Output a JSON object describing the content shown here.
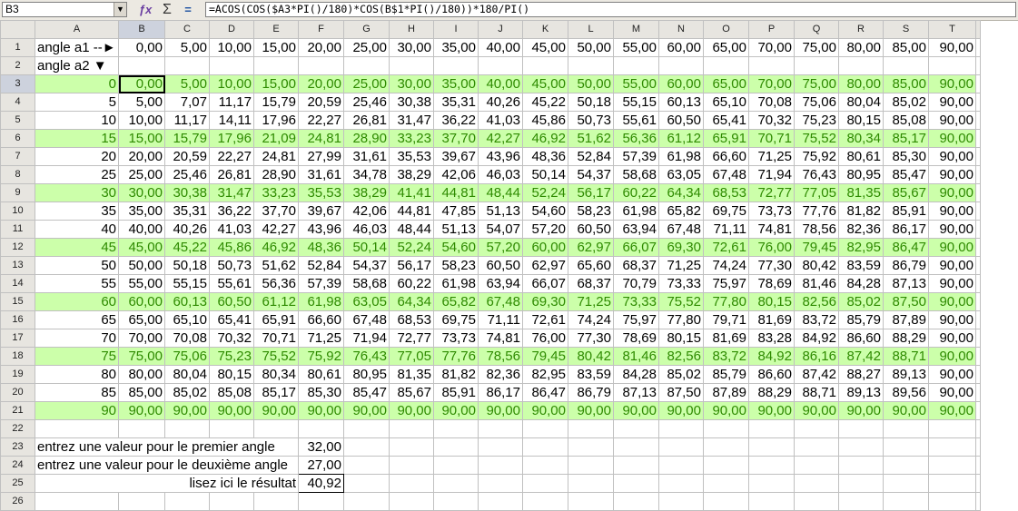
{
  "toolbar": {
    "cell_ref": "B3",
    "formula": "=ACOS(COS($A3*PI()/180)*COS(B$1*PI()/180))*180/PI()",
    "icons": [
      "function-wizard-icon",
      "sum-icon",
      "equals-icon"
    ]
  },
  "columns": [
    "A",
    "B",
    "C",
    "D",
    "E",
    "F",
    "G",
    "H",
    "I",
    "J",
    "K",
    "L",
    "M",
    "N",
    "O",
    "P",
    "Q",
    "R",
    "S",
    "T"
  ],
  "row1": {
    "label": "angle a1 --►",
    "values": [
      "0,00",
      "5,00",
      "10,00",
      "15,00",
      "20,00",
      "25,00",
      "30,00",
      "35,00",
      "40,00",
      "45,00",
      "50,00",
      "55,00",
      "60,00",
      "65,00",
      "70,00",
      "75,00",
      "80,00",
      "85,00",
      "90,00"
    ]
  },
  "row2": {
    "label": "angle a2 ▼"
  },
  "data_rows": [
    {
      "a": "0",
      "green": true,
      "v": [
        "0,00",
        "5,00",
        "10,00",
        "15,00",
        "20,00",
        "25,00",
        "30,00",
        "35,00",
        "40,00",
        "45,00",
        "50,00",
        "55,00",
        "60,00",
        "65,00",
        "70,00",
        "75,00",
        "80,00",
        "85,00",
        "90,00"
      ]
    },
    {
      "a": "5",
      "green": false,
      "v": [
        "5,00",
        "7,07",
        "11,17",
        "15,79",
        "20,59",
        "25,46",
        "30,38",
        "35,31",
        "40,26",
        "45,22",
        "50,18",
        "55,15",
        "60,13",
        "65,10",
        "70,08",
        "75,06",
        "80,04",
        "85,02",
        "90,00"
      ]
    },
    {
      "a": "10",
      "green": false,
      "v": [
        "10,00",
        "11,17",
        "14,11",
        "17,96",
        "22,27",
        "26,81",
        "31,47",
        "36,22",
        "41,03",
        "45,86",
        "50,73",
        "55,61",
        "60,50",
        "65,41",
        "70,32",
        "75,23",
        "80,15",
        "85,08",
        "90,00"
      ]
    },
    {
      "a": "15",
      "green": true,
      "v": [
        "15,00",
        "15,79",
        "17,96",
        "21,09",
        "24,81",
        "28,90",
        "33,23",
        "37,70",
        "42,27",
        "46,92",
        "51,62",
        "56,36",
        "61,12",
        "65,91",
        "70,71",
        "75,52",
        "80,34",
        "85,17",
        "90,00"
      ]
    },
    {
      "a": "20",
      "green": false,
      "v": [
        "20,00",
        "20,59",
        "22,27",
        "24,81",
        "27,99",
        "31,61",
        "35,53",
        "39,67",
        "43,96",
        "48,36",
        "52,84",
        "57,39",
        "61,98",
        "66,60",
        "71,25",
        "75,92",
        "80,61",
        "85,30",
        "90,00"
      ]
    },
    {
      "a": "25",
      "green": false,
      "v": [
        "25,00",
        "25,46",
        "26,81",
        "28,90",
        "31,61",
        "34,78",
        "38,29",
        "42,06",
        "46,03",
        "50,14",
        "54,37",
        "58,68",
        "63,05",
        "67,48",
        "71,94",
        "76,43",
        "80,95",
        "85,47",
        "90,00"
      ]
    },
    {
      "a": "30",
      "green": true,
      "v": [
        "30,00",
        "30,38",
        "31,47",
        "33,23",
        "35,53",
        "38,29",
        "41,41",
        "44,81",
        "48,44",
        "52,24",
        "56,17",
        "60,22",
        "64,34",
        "68,53",
        "72,77",
        "77,05",
        "81,35",
        "85,67",
        "90,00"
      ]
    },
    {
      "a": "35",
      "green": false,
      "v": [
        "35,00",
        "35,31",
        "36,22",
        "37,70",
        "39,67",
        "42,06",
        "44,81",
        "47,85",
        "51,13",
        "54,60",
        "58,23",
        "61,98",
        "65,82",
        "69,75",
        "73,73",
        "77,76",
        "81,82",
        "85,91",
        "90,00"
      ]
    },
    {
      "a": "40",
      "green": false,
      "v": [
        "40,00",
        "40,26",
        "41,03",
        "42,27",
        "43,96",
        "46,03",
        "48,44",
        "51,13",
        "54,07",
        "57,20",
        "60,50",
        "63,94",
        "67,48",
        "71,11",
        "74,81",
        "78,56",
        "82,36",
        "86,17",
        "90,00"
      ]
    },
    {
      "a": "45",
      "green": true,
      "v": [
        "45,00",
        "45,22",
        "45,86",
        "46,92",
        "48,36",
        "50,14",
        "52,24",
        "54,60",
        "57,20",
        "60,00",
        "62,97",
        "66,07",
        "69,30",
        "72,61",
        "76,00",
        "79,45",
        "82,95",
        "86,47",
        "90,00"
      ]
    },
    {
      "a": "50",
      "green": false,
      "v": [
        "50,00",
        "50,18",
        "50,73",
        "51,62",
        "52,84",
        "54,37",
        "56,17",
        "58,23",
        "60,50",
        "62,97",
        "65,60",
        "68,37",
        "71,25",
        "74,24",
        "77,30",
        "80,42",
        "83,59",
        "86,79",
        "90,00"
      ]
    },
    {
      "a": "55",
      "green": false,
      "v": [
        "55,00",
        "55,15",
        "55,61",
        "56,36",
        "57,39",
        "58,68",
        "60,22",
        "61,98",
        "63,94",
        "66,07",
        "68,37",
        "70,79",
        "73,33",
        "75,97",
        "78,69",
        "81,46",
        "84,28",
        "87,13",
        "90,00"
      ]
    },
    {
      "a": "60",
      "green": true,
      "v": [
        "60,00",
        "60,13",
        "60,50",
        "61,12",
        "61,98",
        "63,05",
        "64,34",
        "65,82",
        "67,48",
        "69,30",
        "71,25",
        "73,33",
        "75,52",
        "77,80",
        "80,15",
        "82,56",
        "85,02",
        "87,50",
        "90,00"
      ]
    },
    {
      "a": "65",
      "green": false,
      "v": [
        "65,00",
        "65,10",
        "65,41",
        "65,91",
        "66,60",
        "67,48",
        "68,53",
        "69,75",
        "71,11",
        "72,61",
        "74,24",
        "75,97",
        "77,80",
        "79,71",
        "81,69",
        "83,72",
        "85,79",
        "87,89",
        "90,00"
      ]
    },
    {
      "a": "70",
      "green": false,
      "v": [
        "70,00",
        "70,08",
        "70,32",
        "70,71",
        "71,25",
        "71,94",
        "72,77",
        "73,73",
        "74,81",
        "76,00",
        "77,30",
        "78,69",
        "80,15",
        "81,69",
        "83,28",
        "84,92",
        "86,60",
        "88,29",
        "90,00"
      ]
    },
    {
      "a": "75",
      "green": true,
      "v": [
        "75,00",
        "75,06",
        "75,23",
        "75,52",
        "75,92",
        "76,43",
        "77,05",
        "77,76",
        "78,56",
        "79,45",
        "80,42",
        "81,46",
        "82,56",
        "83,72",
        "84,92",
        "86,16",
        "87,42",
        "88,71",
        "90,00"
      ]
    },
    {
      "a": "80",
      "green": false,
      "v": [
        "80,00",
        "80,04",
        "80,15",
        "80,34",
        "80,61",
        "80,95",
        "81,35",
        "81,82",
        "82,36",
        "82,95",
        "83,59",
        "84,28",
        "85,02",
        "85,79",
        "86,60",
        "87,42",
        "88,27",
        "89,13",
        "90,00"
      ]
    },
    {
      "a": "85",
      "green": false,
      "v": [
        "85,00",
        "85,02",
        "85,08",
        "85,17",
        "85,30",
        "85,47",
        "85,67",
        "85,91",
        "86,17",
        "86,47",
        "86,79",
        "87,13",
        "87,50",
        "87,89",
        "88,29",
        "88,71",
        "89,13",
        "89,56",
        "90,00"
      ]
    },
    {
      "a": "90",
      "green": true,
      "v": [
        "90,00",
        "90,00",
        "90,00",
        "90,00",
        "90,00",
        "90,00",
        "90,00",
        "90,00",
        "90,00",
        "90,00",
        "90,00",
        "90,00",
        "90,00",
        "90,00",
        "90,00",
        "90,00",
        "90,00",
        "90,00",
        "90,00"
      ]
    }
  ],
  "inputs": [
    {
      "row": "23",
      "label": "entrez une valeur pour le premier angle",
      "value": "32,00"
    },
    {
      "row": "24",
      "label": "entrez une valeur pour le deuxième angle",
      "value": "27,00"
    },
    {
      "row": "25",
      "label": "lisez ici le résultat",
      "value": "40,92"
    }
  ],
  "colors": {
    "green_fill": "#ccffaa",
    "green_text": "#2e8b00",
    "header_bg": "#e7e5e0"
  }
}
